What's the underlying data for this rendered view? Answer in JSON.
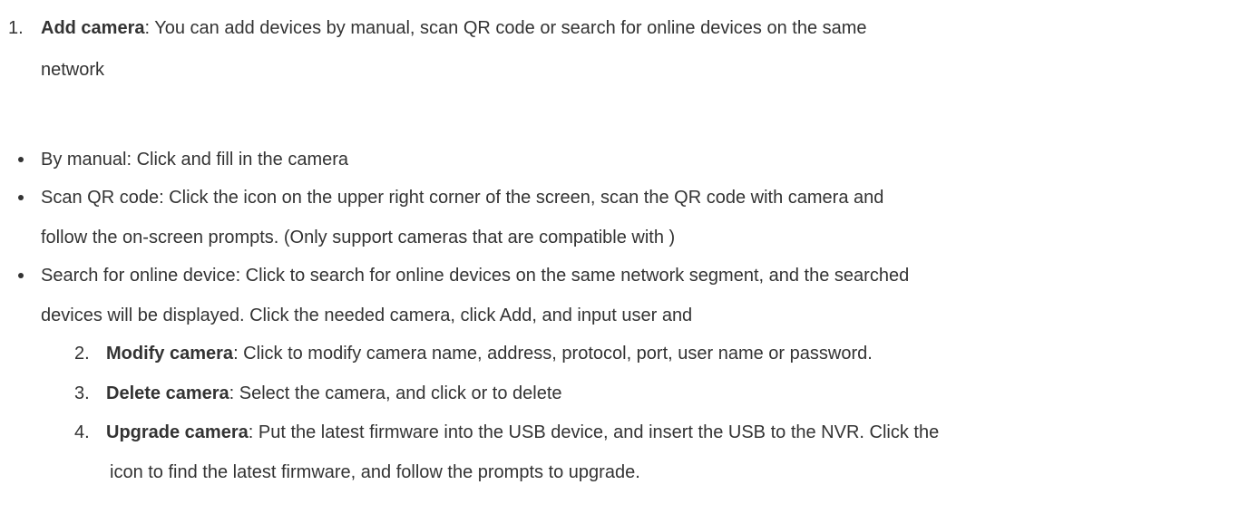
{
  "items": {
    "item1": {
      "number": "1.",
      "title": "Add camera",
      "text_line1": ": You can add devices by manual, scan QR code or search for online devices on the same",
      "text_line2": "network"
    },
    "bullets": [
      {
        "line1": "By manual: Click  and fill in the camera"
      },
      {
        "line1": "Scan QR code: Click the icon on the upper right corner of the screen, scan the QR code with camera and",
        "line2": "follow the on-screen prompts. (Only support cameras that are compatible with )"
      },
      {
        "line1": "Search for online device: Click to search for online devices on the same network segment, and the searched",
        "line2": "devices will be displayed. Click the needed camera, click Add, and input user and"
      }
    ],
    "item2": {
      "number": "2.",
      "title": "Modify camera",
      "text": ": Click to modify camera name, address, protocol, port, user name or password."
    },
    "item3": {
      "number": "3.",
      "title": "Delete camera",
      "text": ": Select the camera, and click or to delete"
    },
    "item4": {
      "number": "4.",
      "title": "Upgrade camera",
      "text_line1": ": Put the latest firmware into the USB device, and insert the USB to the NVR. Click the",
      "text_line2": "icon to find the latest firmware, and follow the prompts to upgrade."
    }
  }
}
